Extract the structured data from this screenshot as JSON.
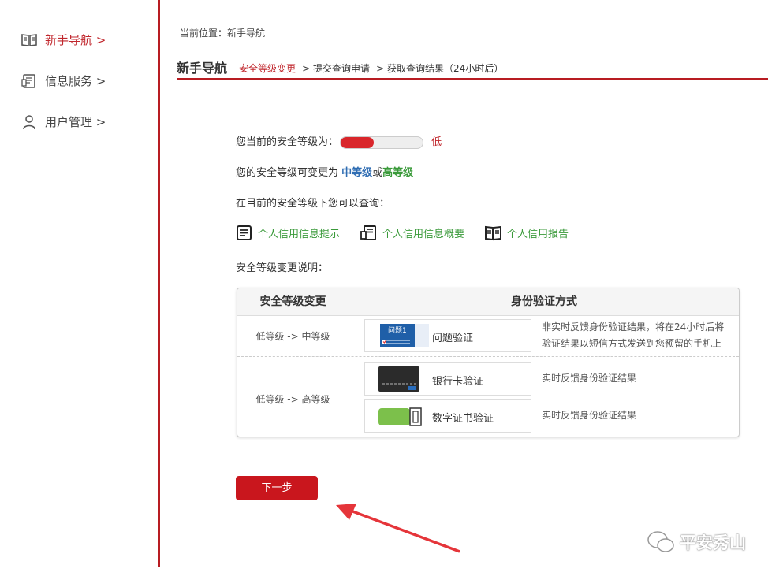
{
  "sidebar": {
    "items": [
      {
        "label": "新手导航 >",
        "icon": "book-icon",
        "active": true
      },
      {
        "label": "信息服务 >",
        "icon": "document-icon",
        "active": false
      },
      {
        "label": "用户管理 >",
        "icon": "user-icon",
        "active": false
      }
    ]
  },
  "breadcrumb": "当前位置：新手导航",
  "header": {
    "title": "新手导航",
    "step_current": "安全等级变更",
    "step_rest": " -> 提交查询申请 -> 获取查询结果（24小时后）"
  },
  "security": {
    "current_label": "您当前的安全等级为：",
    "level_text": "低",
    "level_fraction": 0.4,
    "change_prefix": "您的安全等级可变更为 ",
    "change_mid": "中等级",
    "change_or": "或",
    "change_high": "高等级",
    "query_label": "在目前的安全等级下您可以查询：",
    "explain_label": "安全等级变更说明："
  },
  "query_links": [
    {
      "label": "个人信用信息提示",
      "icon": "document-list-icon"
    },
    {
      "label": "个人信用信息概要",
      "icon": "document-summary-icon"
    },
    {
      "label": "个人信用报告",
      "icon": "open-book-icon"
    }
  ],
  "table": {
    "col1": "安全等级变更",
    "col2": "身份验证方式",
    "row1_level": "低等级 -> 中等级",
    "row2_level": "低等级 -> 高等级",
    "methods": [
      {
        "label": "问题验证",
        "image_text": "问题1",
        "desc_line1": "非实时反馈身份验证结果，将在24小时后将",
        "desc_line2": "验证结果以短信方式发送到您预留的手机上"
      },
      {
        "label": "银行卡验证",
        "desc_line1": "实时反馈身份验证结果"
      },
      {
        "label": "数字证书验证",
        "desc_line1": "实时反馈身份验证结果"
      }
    ]
  },
  "next_button": "下一步",
  "watermark": "平安秀山",
  "colors": {
    "brand_red": "#c9161d",
    "link_green": "#3a9a3a",
    "mid_blue": "#2f6db3"
  }
}
